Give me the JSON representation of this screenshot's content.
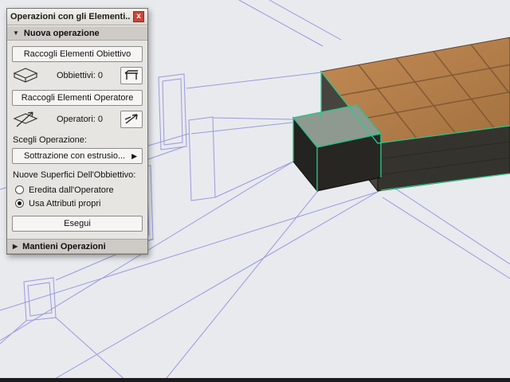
{
  "window": {
    "title": "Operazioni con gli Elementi..."
  },
  "icons": {
    "close": "x",
    "expanded": "▼",
    "collapsed": "▶",
    "dropdown_more": "▶"
  },
  "palette": {
    "sections": {
      "nuova": "Nuova operazione",
      "mantieni": "Mantieni Operazioni"
    },
    "buttons": {
      "raccogli_obiettivo": "Raccogli Elementi Obiettivo",
      "raccogli_operatore": "Raccogli Elementi Operatore",
      "esegui": "Esegui"
    },
    "counters": {
      "obbiettivi_label": "Obbiettivi:",
      "obbiettivi_count": "0",
      "operatori_label": "Operatori:",
      "operatori_count": "0"
    },
    "labels": {
      "scegli_operazione": "Scegli Operazione:",
      "nuove_superfici": "Nuove Superfici Dell'Obbiettivo:"
    },
    "dropdown": {
      "value": "Sottrazione con estrusio..."
    },
    "radios": [
      {
        "label": "Eredita dall'Operatore",
        "selected": false
      },
      {
        "label": "Usa Attributi propri",
        "selected": true
      }
    ]
  },
  "colors": {
    "viewport_bg": "#e8eaee",
    "wireframe": "#9a9ade",
    "selection_green": "#2bc98c",
    "palette_bg": "#e7e5e1",
    "header_bg": "#cecbc6",
    "button_bg": "#f6f5f3",
    "close_red": "#c7473c",
    "bottom_bar": "#1c1c1e"
  }
}
